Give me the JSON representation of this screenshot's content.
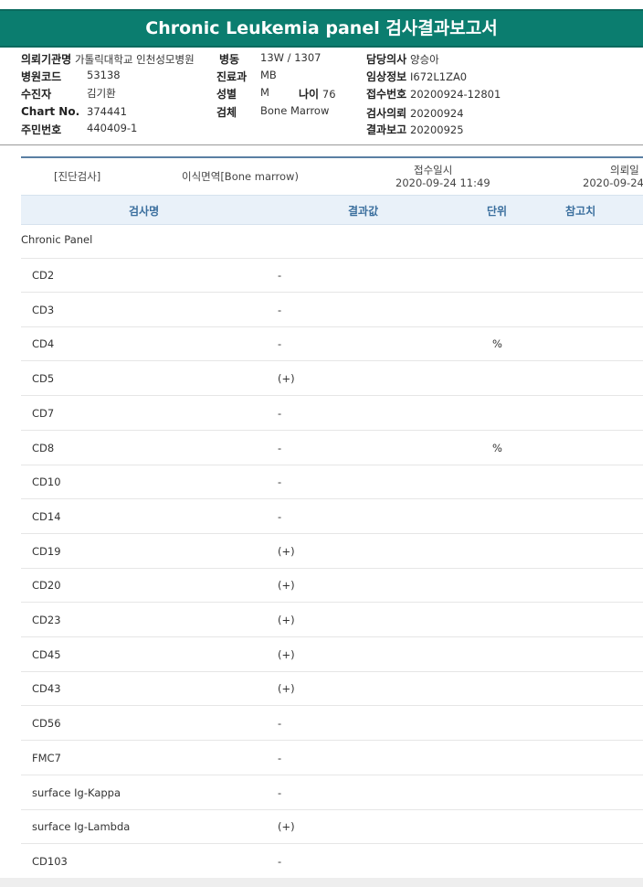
{
  "title": "Chronic Leukemia panel 검사결과보고서",
  "patient": {
    "hospital_label": "의뢰기관명",
    "hospital_value": "가톨릭대학교 인천성모병원",
    "ward_label": "병동",
    "ward_value": "13W / 1307",
    "doctor_label": "담당의사",
    "doctor_value": "양승아",
    "code_label": "병원코드",
    "code_value": "53138",
    "dept_label": "진료과",
    "dept_value": "MB",
    "clinical_label": "임상정보",
    "clinical_value": "I672L1ZA0",
    "recipient_label": "수진자",
    "recipient_value": "김기환",
    "sex_label": "성별",
    "sex_value": "M",
    "age_label": "나이",
    "age_value": "76",
    "receipt_label": "접수번호",
    "receipt_value": "20200924-12801",
    "chart_label": "Chart No.",
    "chart_value": "374441",
    "specimen_label": "검체",
    "specimen_value": "Bone Marrow",
    "request_label": "검사의뢰",
    "request_value": "20200924",
    "rrn_label": "주민번호",
    "rrn_value": "440409-1",
    "report_label": "결과보고",
    "report_value": "20200925"
  },
  "request_row": {
    "category": "[진단검사]",
    "test": "이식면역[Bone marrow)",
    "received_label": "접수일시",
    "received_value": "2020-09-24 11:49",
    "requested_label": "의뢰일",
    "requested_value": "2020-09-24"
  },
  "columns": {
    "name": "검사명",
    "result": "결과값",
    "unit": "단위",
    "reference": "참고치"
  },
  "group_name": "Chronic Panel",
  "rows": [
    {
      "name": "CD2",
      "result": "-",
      "unit": ""
    },
    {
      "name": "CD3",
      "result": "-",
      "unit": ""
    },
    {
      "name": "CD4",
      "result": "-",
      "unit": "%"
    },
    {
      "name": "CD5",
      "result": "(+)",
      "unit": ""
    },
    {
      "name": "CD7",
      "result": "-",
      "unit": ""
    },
    {
      "name": "CD8",
      "result": "-",
      "unit": "%"
    },
    {
      "name": "CD10",
      "result": "-",
      "unit": ""
    },
    {
      "name": "CD14",
      "result": "-",
      "unit": ""
    },
    {
      "name": "CD19",
      "result": "(+)",
      "unit": ""
    },
    {
      "name": "CD20",
      "result": "(+)",
      "unit": ""
    },
    {
      "name": "CD23",
      "result": "(+)",
      "unit": ""
    },
    {
      "name": "CD45",
      "result": "(+)",
      "unit": ""
    },
    {
      "name": "CD43",
      "result": "(+)",
      "unit": ""
    },
    {
      "name": "CD56",
      "result": "-",
      "unit": ""
    },
    {
      "name": "FMC7",
      "result": "-",
      "unit": ""
    },
    {
      "name": "surface Ig-Kappa",
      "result": "-",
      "unit": ""
    },
    {
      "name": "surface Ig-Lambda",
      "result": "(+)",
      "unit": ""
    },
    {
      "name": "CD103",
      "result": "-",
      "unit": ""
    }
  ]
}
